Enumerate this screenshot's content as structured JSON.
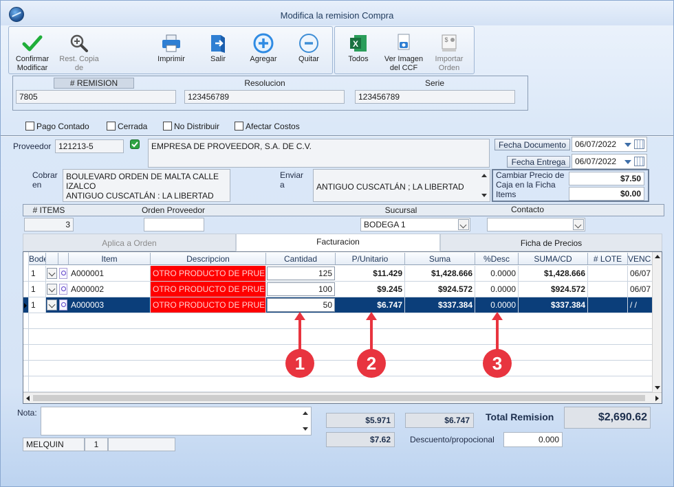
{
  "window": {
    "title": "Modifica la remision Compra"
  },
  "toolbar": {
    "confirm": "Confirmar Modificar",
    "restore": "Rest. Copia de",
    "print": "Imprimir",
    "exit": "Salir",
    "add": "Agregar",
    "remove": "Quitar",
    "all": "Todos",
    "view_image": "Ver Imagen del CCF",
    "import_order": "Importar Orden"
  },
  "header": {
    "remision_label": "# REMISION",
    "remision_value": "7805",
    "resolucion_label": "Resolucion",
    "resolucion_value": "123456789",
    "serie_label": "Serie",
    "serie_value": "123456789"
  },
  "checks": {
    "pago_contado": "Pago Contado",
    "cerrada": "Cerrada",
    "no_distribuir": "No Distribuir",
    "afectar_costos": "Afectar Costos"
  },
  "provider": {
    "label": "Proveedor",
    "code": "121213-5",
    "name": "EMPRESA DE PROVEEDOR, S.A. DE C.V.",
    "fecha_documento_label": "Fecha Documento",
    "fecha_documento": "06/07/2022",
    "fecha_entrega_label": "Fecha Entrega",
    "fecha_entrega": "06/07/2022",
    "cobrar_label": "Cobrar en",
    "cobrar_line1": "BOULEVARD ORDEN DE MALTA CALLE",
    "cobrar_line2": "IZALCO",
    "cobrar_line3": "ANTIGUO CUSCATLÁN : LA LIBERTAD",
    "enviar_label": "Enviar a",
    "enviar_value": "ANTIGUO CUSCATLÁN ; LA LIBERTAD",
    "price_change_label": "Cambiar Precio de Caja en la Ficha Items",
    "price1": "$7.50",
    "price2": "$0.00"
  },
  "info": {
    "items_label": "# ITEMS",
    "items_value": "3",
    "orden_label": "Orden Proveedor",
    "orden_value": "",
    "sucursal_label": "Sucursal",
    "sucursal_value": "BODEGA 1",
    "contacto_label": "Contacto",
    "contacto_value": ""
  },
  "tabs": [
    "Aplica a Orden",
    "Facturacion",
    "Ficha de Precios"
  ],
  "grid": {
    "columns": [
      "Bodega",
      "Item",
      "Descripcion",
      "Cantidad",
      "P/Unitario",
      "Suma",
      "%Desc",
      "SUMA/CD",
      "# LOTE",
      "VENC"
    ],
    "rows": [
      {
        "bodega": "1",
        "item": "A000001",
        "desc": "OTRO PRODUCTO DE PRUEBA",
        "cantidad": "125",
        "unit": "$11.429",
        "suma": "$1,428.666",
        "desc_pct": "0.0000",
        "sumacd": "$1,428.666",
        "lote": "",
        "venc": "06/07"
      },
      {
        "bodega": "1",
        "item": "A000002",
        "desc": "OTRO PRODUCTO DE PRUEBA",
        "cantidad": "100",
        "unit": "$9.245",
        "suma": "$924.572",
        "desc_pct": "0.0000",
        "sumacd": "$924.572",
        "lote": "",
        "venc": "06/07"
      },
      {
        "bodega": "1",
        "item": "A000003",
        "desc": "OTRO PRODUCTO DE PRUEBA",
        "cantidad": "50",
        "unit": "$6.747",
        "suma": "$337.384",
        "desc_pct": "0.0000",
        "sumacd": "$337.384",
        "lote": "",
        "venc": "/ /"
      }
    ]
  },
  "markers": [
    "1",
    "2",
    "3"
  ],
  "footer": {
    "nota_label": "Nota:",
    "nota_value": "",
    "user": "MELQUIN",
    "user_num": "1",
    "sum1": "$5.971",
    "sum2": "$6.747",
    "sum3": "$7.62",
    "descuento_label": "Descuento/propocional",
    "descuento_value": "0.000",
    "total_label": "Total Remision",
    "total_value": "$2,690.62"
  },
  "colors": {
    "selected_row": "#0b3e7a",
    "description_cell": "#ff0000",
    "marker": "#e8343f"
  }
}
